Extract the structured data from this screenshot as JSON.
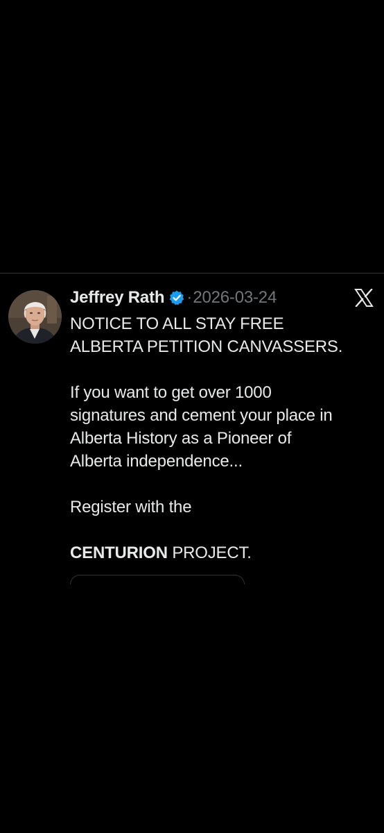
{
  "tweet": {
    "author_name": "Jeffrey Rath",
    "verified": true,
    "separator": "·",
    "date": "2026-03-24",
    "platform_logo": "x-logo",
    "body": {
      "para1_lines": [
        "NOTICE TO ALL STAY FREE",
        "ALBERTA PETITION CANVASSERS."
      ],
      "para2_lines": [
        "If you want to get over 1000",
        "signatures and cement your place in",
        "Alberta History as a Pioneer of",
        "Alberta independence..."
      ],
      "para3_lines": [
        "Register with the"
      ],
      "para4_bold": "CENTURION",
      "para4_rest": " PROJECT."
    }
  },
  "colors": {
    "background": "#000000",
    "text_primary": "#e7e9ea",
    "text_secondary": "#71767b",
    "verified_blue": "#1d9bf0",
    "divider": "#2f3336"
  }
}
